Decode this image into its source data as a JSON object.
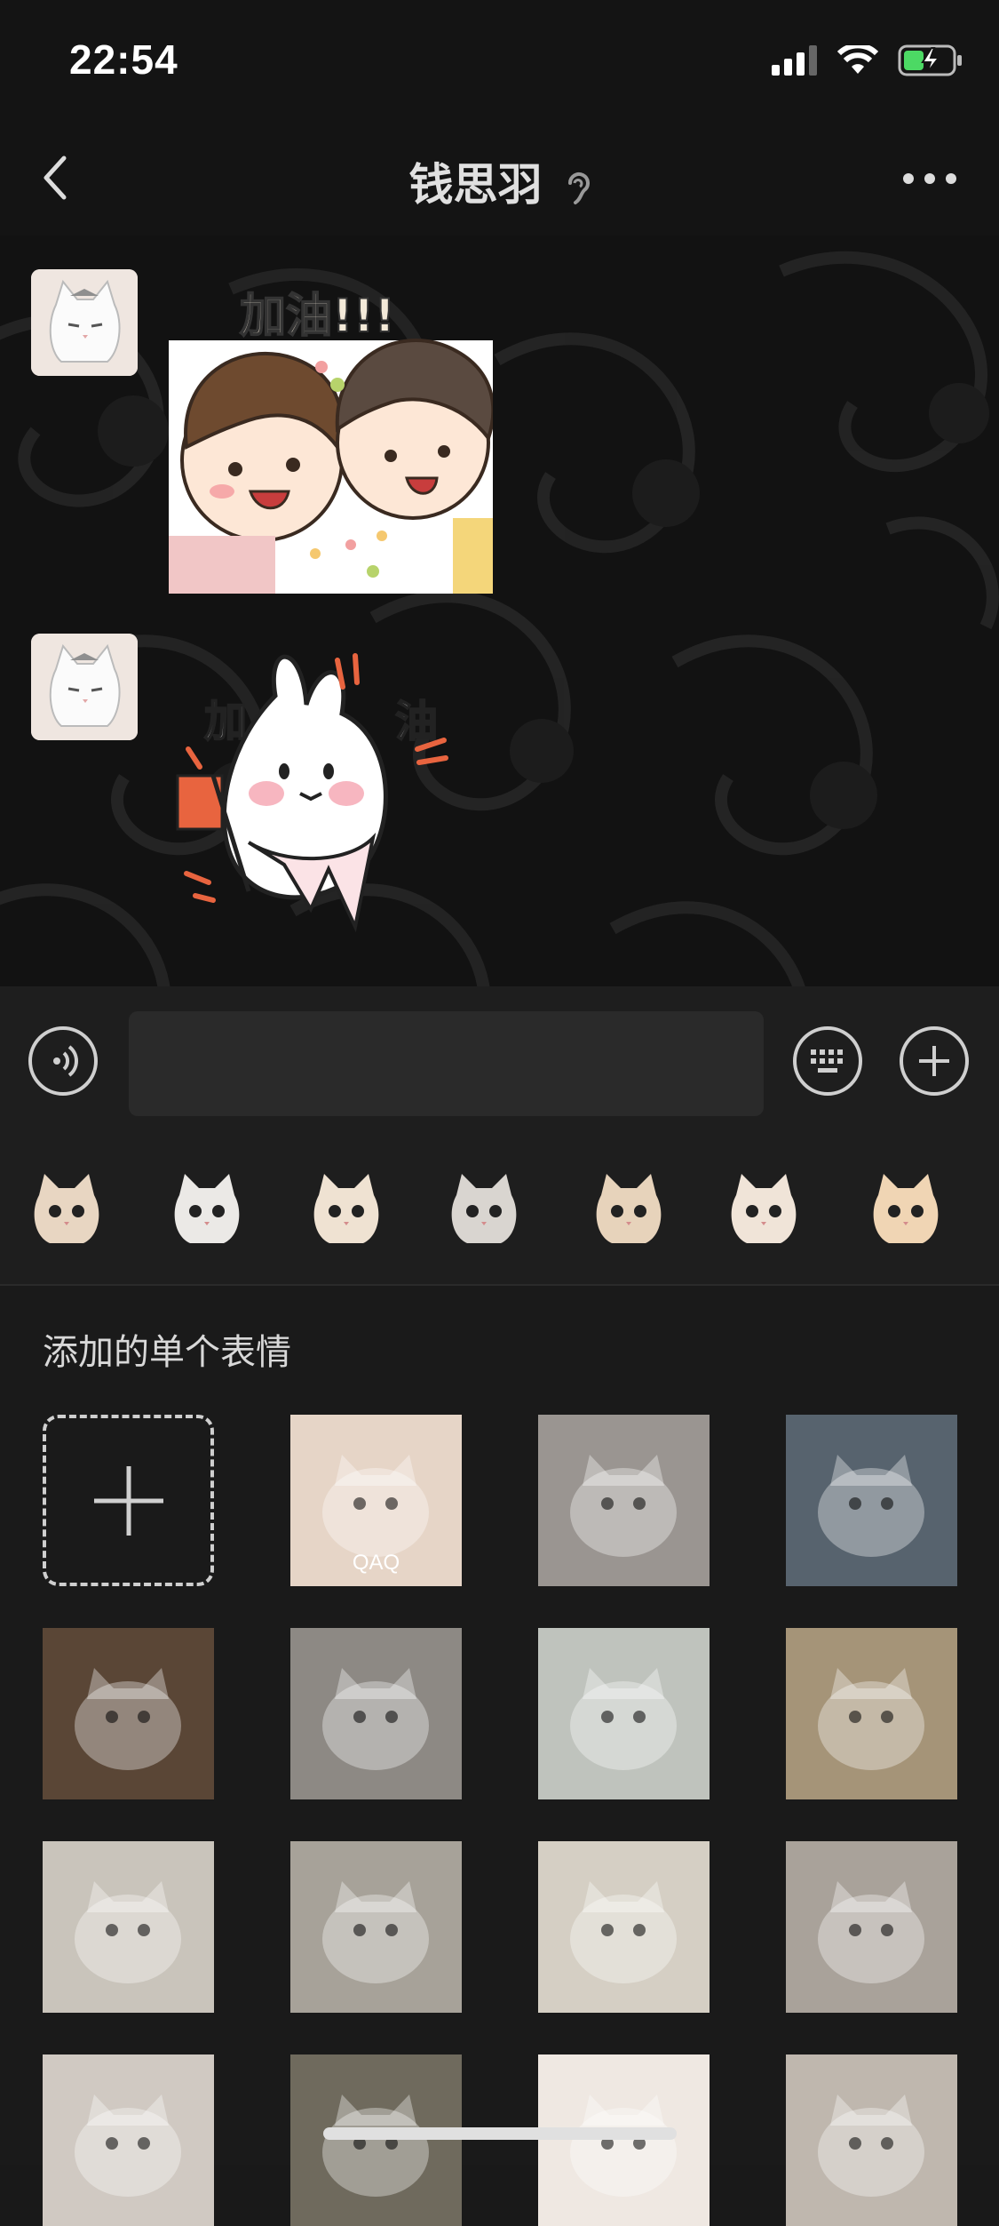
{
  "status": {
    "time": "22:54"
  },
  "nav": {
    "title": "钱思羽",
    "back_icon": "chevron-left-icon",
    "more_icon": "more-dots-icon",
    "ear_icon": "ear-icon"
  },
  "chat": {
    "messages": [
      {
        "sender": "contact",
        "type": "sticker",
        "sticker_text": "加油!!!"
      },
      {
        "sender": "contact",
        "type": "sticker",
        "sticker_text_left": "加",
        "sticker_text_right": "油"
      }
    ]
  },
  "input": {
    "voice_icon": "voice-icon",
    "keyboard_icon": "keyboard-icon",
    "add_icon": "plus-icon"
  },
  "sticker_tabs": {
    "count": 7
  },
  "panel": {
    "title": "添加的单个表情",
    "items": [
      {
        "kind": "add",
        "icon": "plus-icon"
      },
      {
        "kind": "sticker",
        "caption": "QAQ",
        "bg": "#e6d5c7"
      },
      {
        "kind": "sticker",
        "caption": "",
        "bg": "#9a9591"
      },
      {
        "kind": "sticker",
        "caption": "",
        "bg": "#57636e"
      },
      {
        "kind": "sticker",
        "caption": "",
        "bg": "#5a4636"
      },
      {
        "kind": "sticker",
        "caption": "",
        "bg": "#8d8984"
      },
      {
        "kind": "sticker",
        "caption": "",
        "bg": "#bfc3bd"
      },
      {
        "kind": "sticker",
        "caption": "",
        "bg": "#a59478"
      },
      {
        "kind": "sticker",
        "caption": "",
        "bg": "#c9c4bb"
      },
      {
        "kind": "sticker",
        "caption": "",
        "bg": "#a7a299"
      },
      {
        "kind": "sticker",
        "caption": "",
        "bg": "#d5cfc4"
      },
      {
        "kind": "sticker",
        "caption": "",
        "bg": "#a9a29a"
      },
      {
        "kind": "sticker",
        "caption": "",
        "bg": "#d0c9c2"
      },
      {
        "kind": "sticker",
        "caption": "",
        "bg": "#6f6a5d"
      },
      {
        "kind": "sticker",
        "caption": "",
        "bg": "#efe8e2"
      },
      {
        "kind": "sticker",
        "caption": "",
        "bg": "#bfb7ae"
      }
    ]
  },
  "colors": {
    "background": "#191919",
    "accent_battery": "#4cd964"
  }
}
